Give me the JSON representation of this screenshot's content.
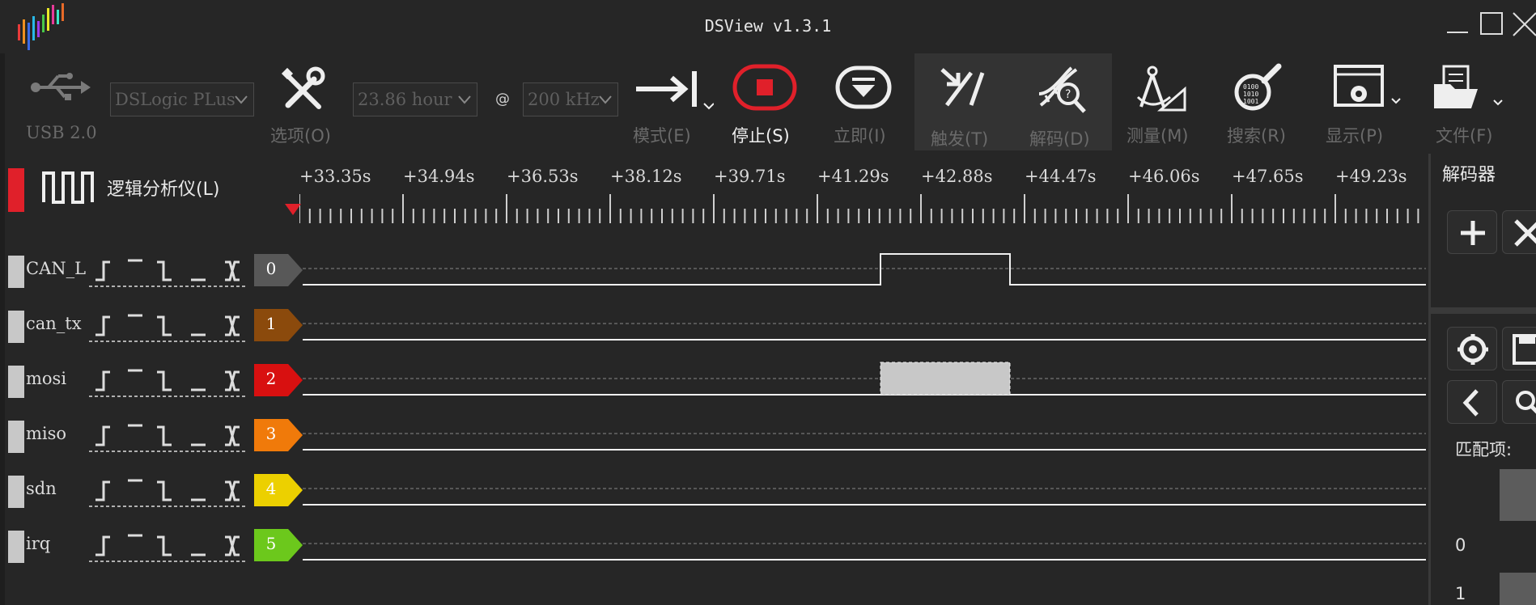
{
  "window": {
    "title": "DSView v1.3.1",
    "controls": [
      "minimize",
      "maximize",
      "close"
    ]
  },
  "toolbar": {
    "usb_label": "USB 2.0",
    "device_select": "DSLogic PLus",
    "options_label": "选项(O)",
    "duration_select": "23.86 hour",
    "at_sign": "@",
    "rate_select": "200 kHz",
    "mode_label": "模式(E)",
    "stop_label": "停止(S)",
    "instant_label": "立即(I)",
    "trigger_label": "触发(T)",
    "decode_label": "解码(D)",
    "measure_label": "测量(M)",
    "search_label": "搜索(R)",
    "display_label": "显示(P)",
    "file_label": "文件(F)",
    "stop_color": "#e0202a"
  },
  "ruler": {
    "group_label": "逻辑分析仪(L)",
    "ticks": [
      "+33.35s",
      "+34.94s",
      "+36.53s",
      "+38.12s",
      "+39.71s",
      "+41.29s",
      "+42.88s",
      "+44.47s",
      "+46.06s",
      "+47.65s",
      "+49.23s"
    ]
  },
  "channels": [
    {
      "index": "0",
      "name": "CAN_L",
      "color": "#585858"
    },
    {
      "index": "1",
      "name": "can_tx",
      "color": "#8b4a0c"
    },
    {
      "index": "2",
      "name": "mosi",
      "color": "#d81010"
    },
    {
      "index": "3",
      "name": "miso",
      "color": "#f07a0a"
    },
    {
      "index": "4",
      "name": "sdn",
      "color": "#ecd000"
    },
    {
      "index": "5",
      "name": "irq",
      "color": "#6cc81c"
    }
  ],
  "decoder_panel": {
    "title": "解码器",
    "match_label": "匹配项:",
    "rows": [
      "0",
      "1"
    ]
  }
}
